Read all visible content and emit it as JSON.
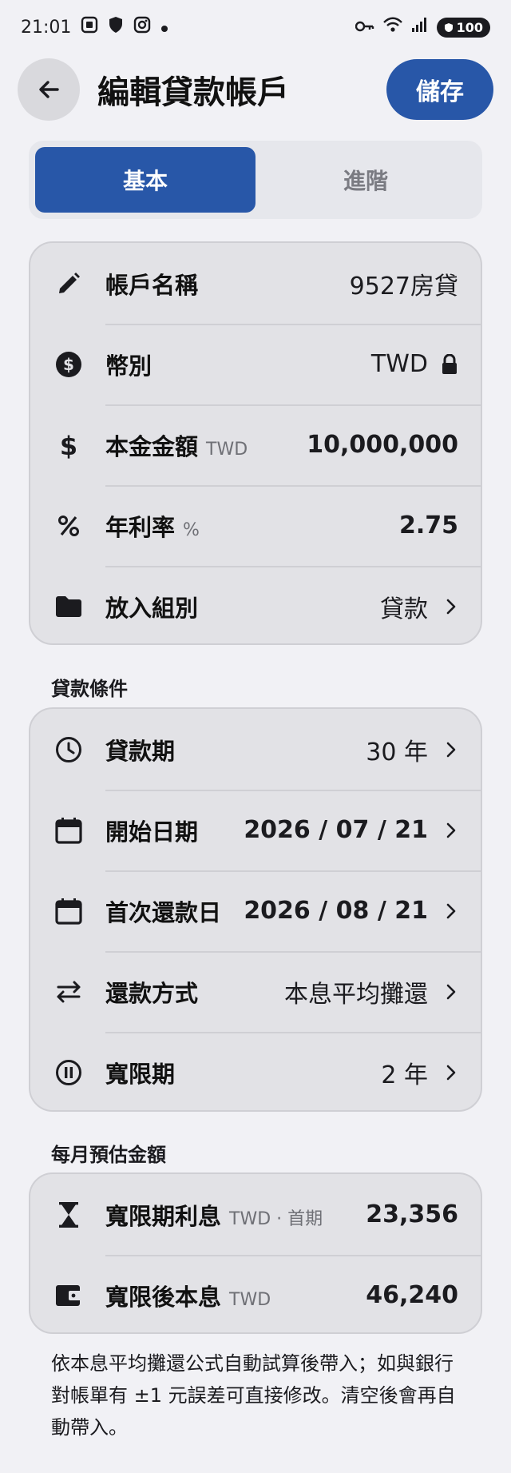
{
  "status": {
    "time": "21:01",
    "battery": "100"
  },
  "header": {
    "title": "編輯貸款帳戶",
    "save_label": "儲存"
  },
  "tabs": [
    {
      "label": "基本",
      "active": true
    },
    {
      "label": "進階",
      "active": false
    }
  ],
  "basic": {
    "account_name": {
      "label": "帳戶名稱",
      "value": "9527房貸"
    },
    "currency": {
      "label": "幣別",
      "value": "TWD"
    },
    "principal": {
      "label": "本金金額",
      "unit": "TWD",
      "value": "10,000,000"
    },
    "rate": {
      "label": "年利率",
      "unit": "%",
      "value": "2.75"
    },
    "group": {
      "label": "放入組別",
      "value": "貸款"
    }
  },
  "loan_terms": {
    "section_title": "貸款條件",
    "term": {
      "label": "貸款期",
      "value": "30 年"
    },
    "start_date": {
      "label": "開始日期",
      "value": "2026 / 07 / 21"
    },
    "first_payment": {
      "label": "首次還款日",
      "value": "2026 / 08 / 21"
    },
    "method": {
      "label": "還款方式",
      "value": "本息平均攤還"
    },
    "grace": {
      "label": "寬限期",
      "value": "2 年"
    }
  },
  "monthly": {
    "section_title": "每月預估金額",
    "grace_interest": {
      "label": "寬限期利息",
      "unit": "TWD · 首期",
      "value": "23,356"
    },
    "after_grace": {
      "label": "寬限後本息",
      "unit": "TWD",
      "value": "46,240"
    }
  },
  "footnote": "依本息平均攤還公式自動試算後帶入；如與銀行對帳單有 ±1 元誤差可直接修改。清空後會再自動帶入。",
  "colors": {
    "accent": "#2857a8",
    "background": "#f1f1f5",
    "card": "#e2e2e6"
  }
}
